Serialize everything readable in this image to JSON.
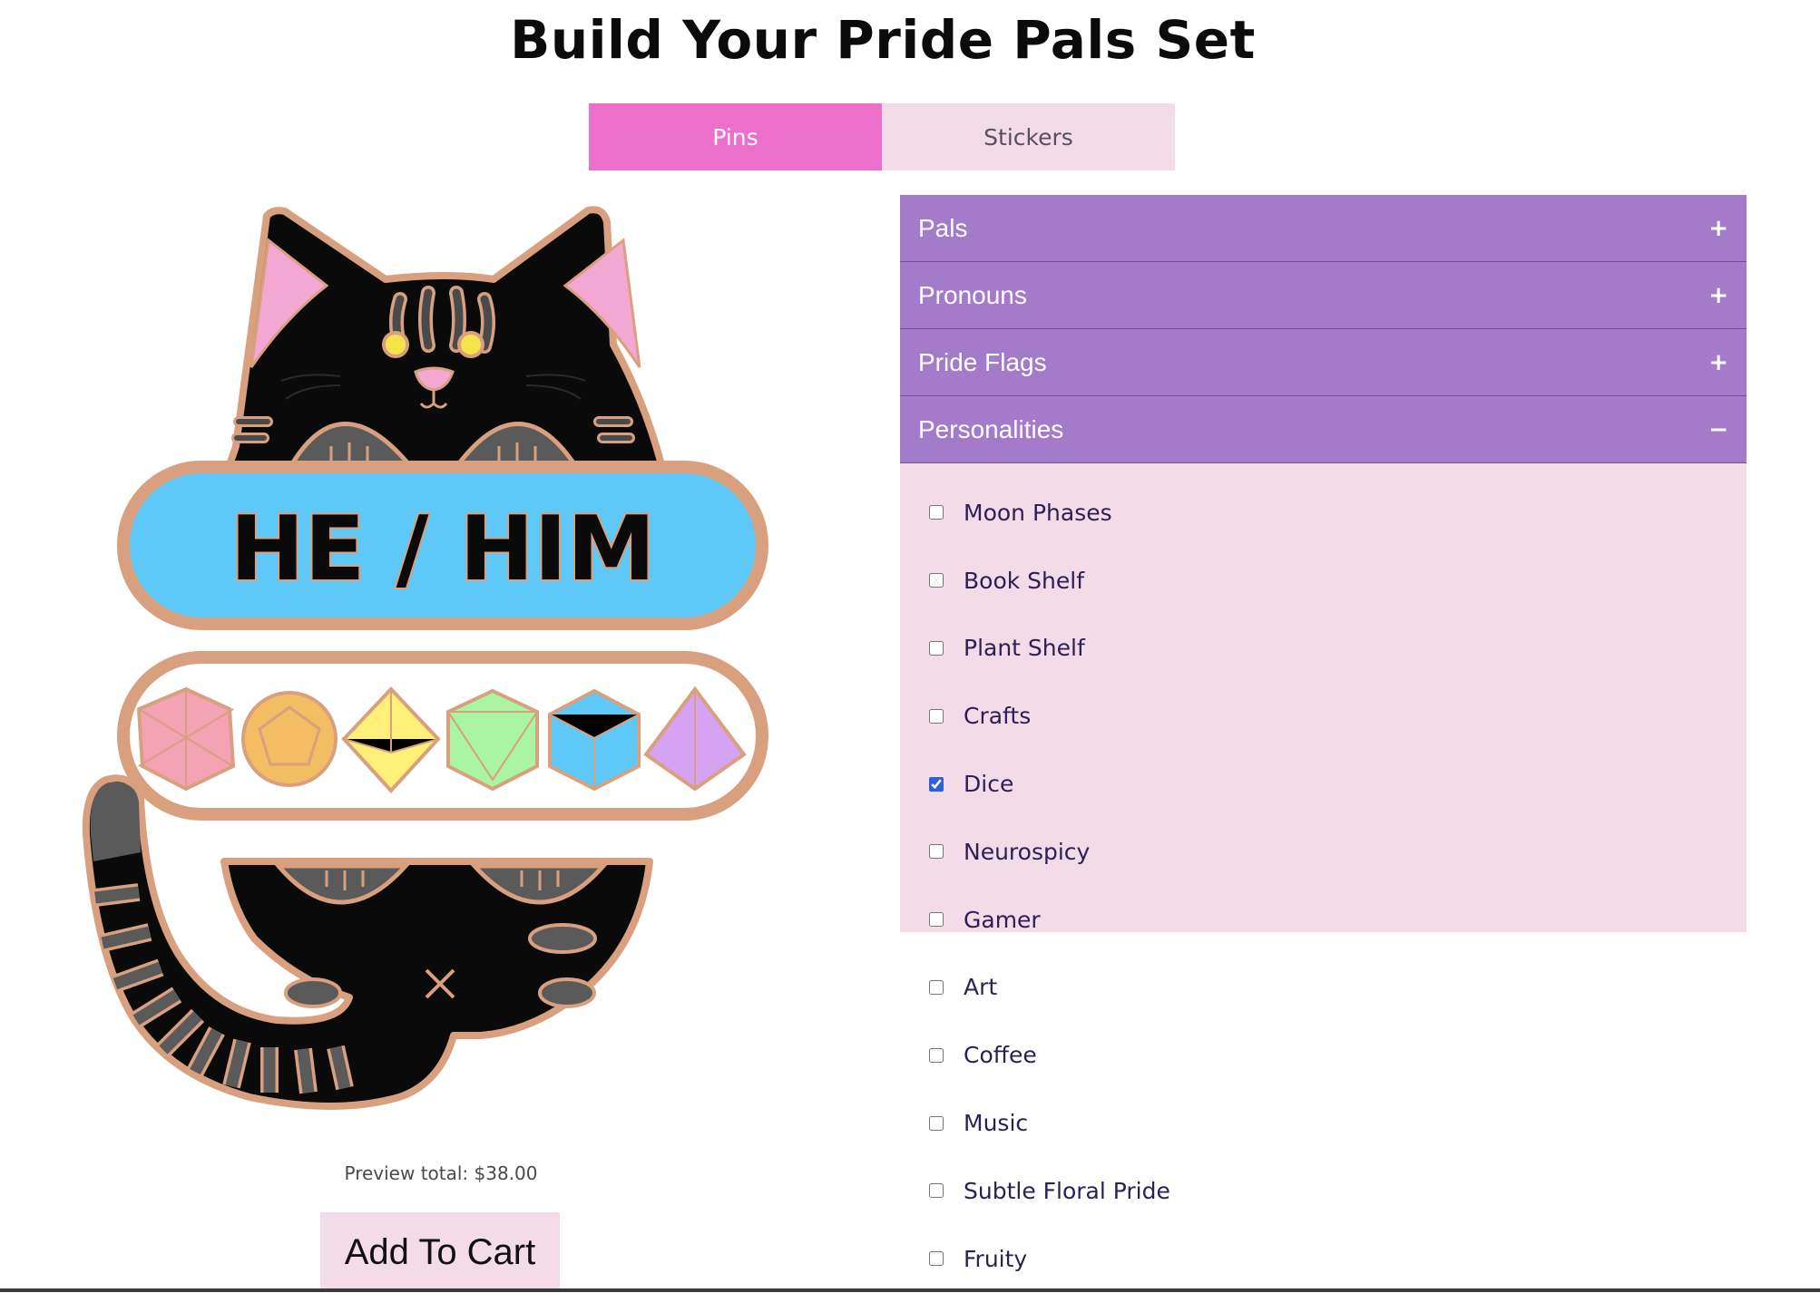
{
  "page": {
    "title": "Build Your Pride Pals Set"
  },
  "tabs": [
    {
      "label": "Pins",
      "active": true
    },
    {
      "label": "Stickers",
      "active": false
    }
  ],
  "preview": {
    "pronoun_text": "HE / HIM",
    "total": "Preview total: $38.00"
  },
  "cart": {
    "button_label": "Add To Cart"
  },
  "accordion": {
    "sections": [
      {
        "label": "Pals",
        "expanded": false,
        "sign": "+"
      },
      {
        "label": "Pronouns",
        "expanded": false,
        "sign": "+"
      },
      {
        "label": "Pride Flags",
        "expanded": false,
        "sign": "+"
      },
      {
        "label": "Personalities",
        "expanded": true,
        "sign": "−"
      }
    ],
    "personalities": [
      {
        "label": "Moon Phases",
        "checked": false
      },
      {
        "label": "Book Shelf",
        "checked": false
      },
      {
        "label": "Plant Shelf",
        "checked": false
      },
      {
        "label": "Crafts",
        "checked": false
      },
      {
        "label": "Dice",
        "checked": true
      },
      {
        "label": "Neurospicy",
        "checked": false
      },
      {
        "label": "Gamer",
        "checked": false
      },
      {
        "label": "Art",
        "checked": false
      },
      {
        "label": "Coffee",
        "checked": false
      },
      {
        "label": "Music",
        "checked": false
      },
      {
        "label": "Subtle Floral Pride",
        "checked": false
      },
      {
        "label": "Fruity",
        "checked": false
      }
    ]
  },
  "colors": {
    "tab_active": "#ec6fcb",
    "tab_inactive": "#f3dce8",
    "accordion_header": "#a47bca",
    "accordion_panel": "#f3dce8",
    "pronoun_badge": "#5ec8f8",
    "pin_outline": "#d9a07f",
    "cat_fur": "#0a0a0a",
    "checkbox_checked": "#2a61d8"
  },
  "icons": {
    "plus": "plus-icon",
    "minus": "minus-icon"
  }
}
